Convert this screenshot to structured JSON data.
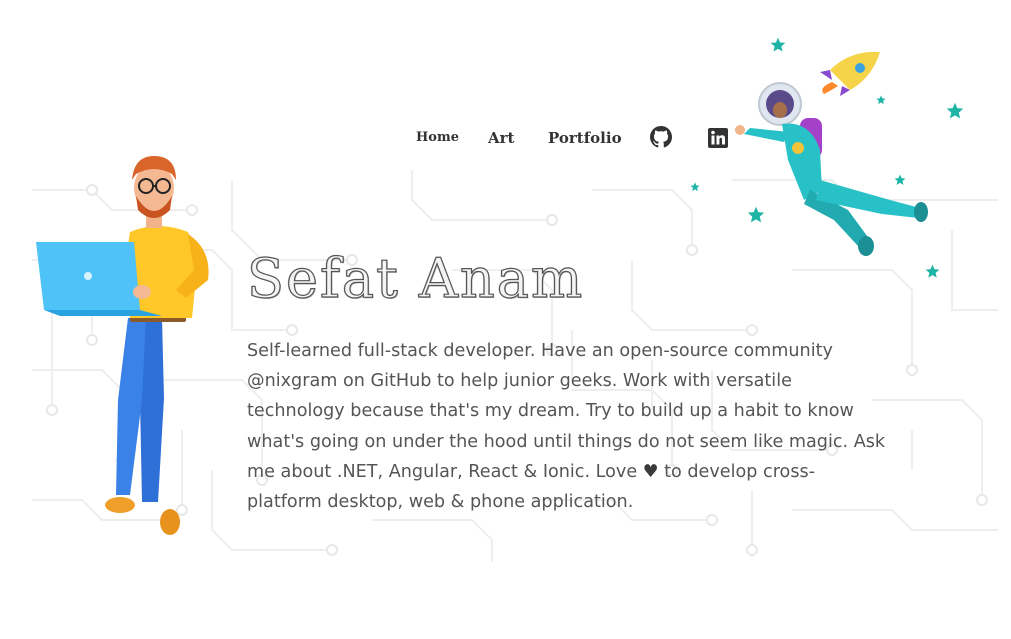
{
  "nav": {
    "home": "Home",
    "art": "Art",
    "portfolio": "Portfolio",
    "github_icon": "github-icon",
    "linkedin_icon": "linkedin-icon"
  },
  "hero": {
    "name": "Sefat Anam",
    "bio_before_heart": "Self-learned full-stack developer. Have an open-source community @nixgram on GitHub to help junior geeks. Work with versatile technology because that's my dream. Try to build up a habit to know what's going on under the hood until things do not seem like magic. Ask me about .NET, Angular, React & Ionic. Love ",
    "heart_icon": "heart-icon",
    "bio_after_heart": " to develop cross-platform desktop, web & phone application."
  },
  "illustrations": {
    "developer": "developer-with-laptop-illustration",
    "astronaut": "astronaut-illustration",
    "rocket": "rocket-icon",
    "stars": "star-icon"
  },
  "colors": {
    "text": "#555555",
    "nav": "#333333",
    "star": "#1fb5a6",
    "circuit": "#efefef"
  }
}
